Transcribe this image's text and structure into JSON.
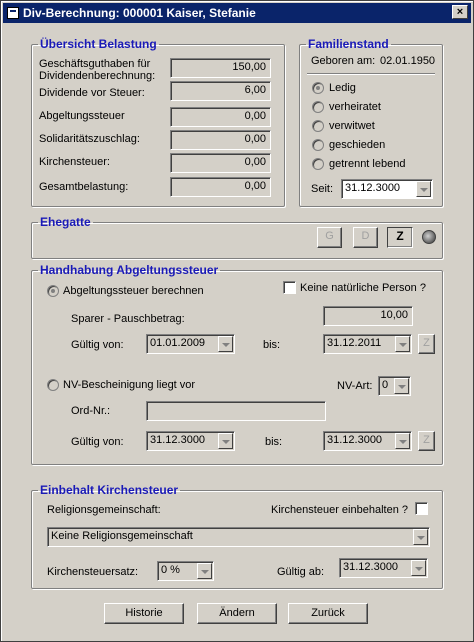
{
  "window": {
    "title": "Div-Berechnung: 000001  Kaiser, Stefanie",
    "close_glyph": "×"
  },
  "uebersicht": {
    "legend": "Übersicht Belastung",
    "rows": [
      {
        "label1": "Geschäftsguthaben für",
        "label2": "Dividendenberechnung:",
        "value": "150,00"
      },
      {
        "label1": "Dividende vor Steuer:",
        "value": "6,00"
      },
      {
        "label1": "Abgeltungssteuer",
        "value": "0,00"
      },
      {
        "label1": "Solidaritätszuschlag:",
        "value": "0,00"
      },
      {
        "label1": "Kirchensteuer:",
        "value": "0,00"
      },
      {
        "label1": "Gesamtbelastung:",
        "value": "0,00"
      }
    ]
  },
  "familienstand": {
    "legend": "Familienstand",
    "geboren_label": "Geboren am:",
    "geboren_value": "02.01.1950",
    "options": [
      "Ledig",
      "verheiratet",
      "verwitwet",
      "geschieden",
      "getrennt lebend"
    ],
    "selected_index": 0,
    "seit_label": "Seit:",
    "seit_value": "31.12.3000"
  },
  "ehegatte": {
    "legend": "Ehegatte",
    "buttons": [
      "G",
      "D",
      "Z"
    ]
  },
  "abgeltung": {
    "legend": "Handhabung Abgeltungssteuer",
    "radio1_label": "Abgeltungssteuer berechnen",
    "keine_nat_label": "Keine natürliche Person ?",
    "sparer_label": "Sparer - Pauschbetrag:",
    "sparer_value": "10,00",
    "gueltig_von_label": "Gültig von:",
    "gueltig_von_value": "01.01.2009",
    "bis_label": "bis:",
    "bis_value": "31.12.2011",
    "z_button": "Z",
    "radio2_label": "NV-Bescheinigung liegt vor",
    "nv_art_label": "NV-Art:",
    "nv_art_value": "0",
    "ord_label": "Ord-Nr.:",
    "ord_value": "",
    "gueltig_von2_label": "Gültig von:",
    "gueltig_von2_value": "31.12.3000",
    "bis2_label": "bis:",
    "bis2_value": "31.12.3000",
    "z_button2": "Z"
  },
  "kirche": {
    "legend": "Einbehalt Kirchensteuer",
    "religion_label": "Religionsgemeinschaft:",
    "einbehalten_label": "Kirchensteuer einbehalten ?",
    "religion_value": "Keine Religionsgemeinschaft",
    "satz_label": "Kirchensteuersatz:",
    "satz_value": "0 %",
    "gueltig_ab_label": "Gültig ab:",
    "gueltig_ab_value": "31.12.3000"
  },
  "footer": {
    "historie": "Historie",
    "aendern": "Ändern",
    "zurueck": "Zurück"
  }
}
